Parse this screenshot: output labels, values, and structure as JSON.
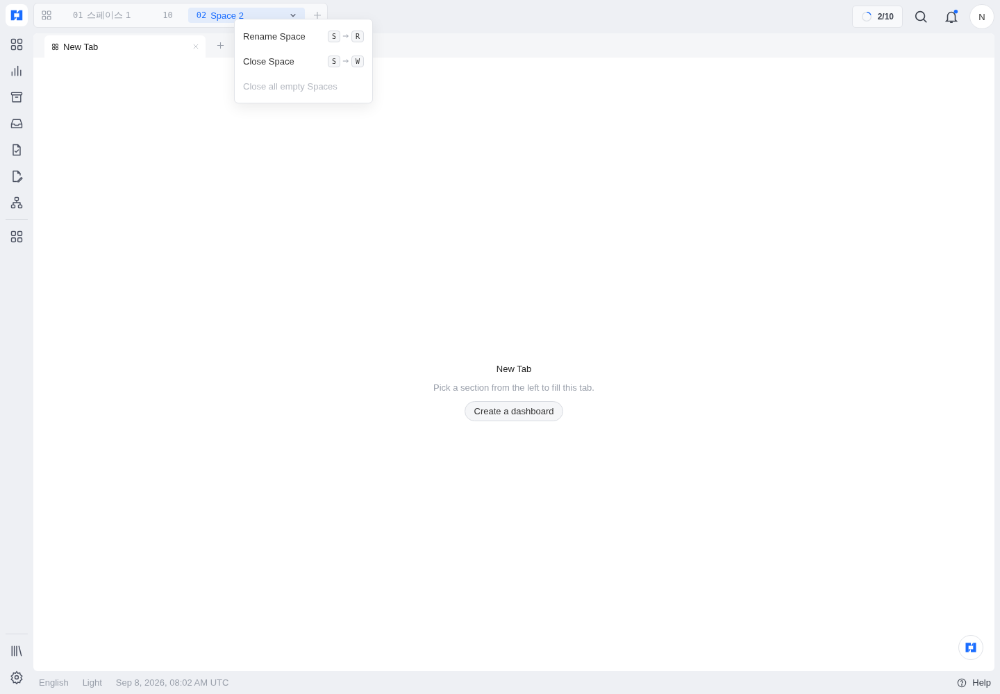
{
  "spaces": [
    {
      "number": "01",
      "name": "스페이스 1",
      "count": "10",
      "selected": false
    },
    {
      "number": "02",
      "name": "Space 2",
      "selected": true
    }
  ],
  "space_menu": [
    {
      "label": "Rename Space",
      "disabled": false,
      "keys": [
        "S",
        "R"
      ]
    },
    {
      "label": "Close Space",
      "disabled": false,
      "keys": [
        "S",
        "W"
      ]
    },
    {
      "label": "Close all empty Spaces",
      "disabled": true
    }
  ],
  "jobs": {
    "reading": "2/10"
  },
  "notifications": {
    "unread": true
  },
  "avatar": "N",
  "tabs": [
    {
      "label": "New Tab",
      "selected": true
    }
  ],
  "empty_state": {
    "title": "New Tab",
    "text": "Pick a section from the left to fill this tab.",
    "button": "Create a dashboard"
  },
  "status_bar": {
    "language": "English",
    "theme": "Light",
    "time": "Sep 8, 2026, 08:02 AM UTC",
    "help": "Help"
  }
}
